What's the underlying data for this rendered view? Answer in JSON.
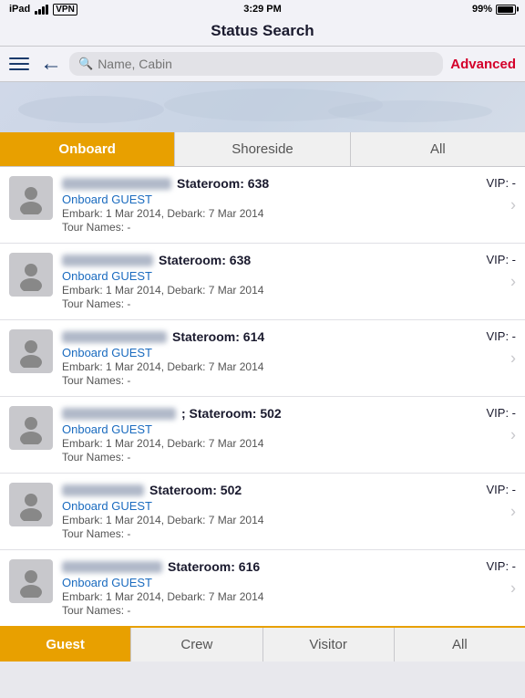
{
  "statusBar": {
    "carrier": "iPad",
    "wifi": "wifi",
    "vpn": "VPN",
    "time": "3:29 PM",
    "battery": "99%"
  },
  "titleBar": {
    "title": "Status Search"
  },
  "navBar": {
    "searchPlaceholder": "Name, Cabin",
    "advancedLabel": "Advanced"
  },
  "topTabs": [
    {
      "label": "Onboard",
      "active": true
    },
    {
      "label": "Shoreside",
      "active": false
    },
    {
      "label": "All",
      "active": false
    }
  ],
  "guests": [
    {
      "nameBlurWidth": "120px",
      "stateroom": "Stateroom: 638",
      "type": "Onboard GUEST",
      "embark": "Embark: 1 Mar 2014, Debark: 7 Mar 2014",
      "tours": "Tour Names: -",
      "vip": "VIP: -"
    },
    {
      "nameBlurWidth": "100px",
      "stateroom": "Stateroom: 638",
      "type": "Onboard GUEST",
      "embark": "Embark: 1 Mar 2014, Debark: 7 Mar 2014",
      "tours": "Tour Names: -",
      "vip": "VIP: -"
    },
    {
      "nameBlurWidth": "115px",
      "stateroom": "Stateroom: 614",
      "type": "Onboard GUEST",
      "embark": "Embark: 1 Mar 2014, Debark: 7 Mar 2014",
      "tours": "Tour Names: -",
      "vip": "VIP: -"
    },
    {
      "nameBlurWidth": "125px",
      "stateroom": "; Stateroom: 502",
      "type": "Onboard GUEST",
      "embark": "Embark: 1 Mar 2014, Debark: 7 Mar 2014",
      "tours": "Tour Names: -",
      "vip": "VIP: -"
    },
    {
      "nameBlurWidth": "90px",
      "stateroom": "Stateroom: 502",
      "type": "Onboard GUEST",
      "embark": "Embark: 1 Mar 2014, Debark: 7 Mar 2014",
      "tours": "Tour Names: -",
      "vip": "VIP: -"
    },
    {
      "nameBlurWidth": "110px",
      "stateroom": "Stateroom: 616",
      "type": "Onboard GUEST",
      "embark": "Embark: 1 Mar 2014, Debark: 7 Mar 2014",
      "tours": "Tour Names: -",
      "vip": "VIP: -"
    }
  ],
  "bottomTabs": [
    {
      "label": "Guest",
      "active": true
    },
    {
      "label": "Crew",
      "active": false
    },
    {
      "label": "Visitor",
      "active": false
    },
    {
      "label": "All",
      "active": false
    }
  ]
}
